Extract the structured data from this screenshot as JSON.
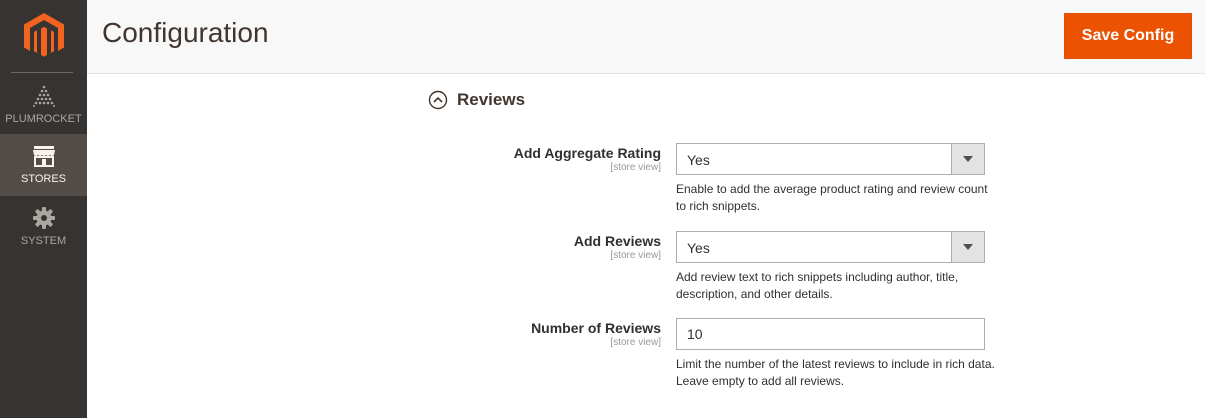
{
  "sidebar": {
    "logo_icon": "magento-logo-icon",
    "items": [
      {
        "label": "PLUMROCKET",
        "icon": "plumrocket-icon",
        "active": false
      },
      {
        "label": "STORES",
        "icon": "store-icon",
        "active": true
      },
      {
        "label": "SYSTEM",
        "icon": "gear-icon",
        "active": false
      }
    ]
  },
  "header": {
    "title": "Configuration",
    "save_label": "Save Config"
  },
  "section": {
    "title": "Reviews",
    "icon": "chevron-up-circle-icon"
  },
  "fields": [
    {
      "label": "Add Aggregate Rating",
      "scope": "[store view]",
      "type": "select",
      "value": "Yes",
      "note": "Enable to add the average product rating and review count to rich snippets."
    },
    {
      "label": "Add Reviews",
      "scope": "[store view]",
      "type": "select",
      "value": "Yes",
      "note": "Add review text to rich snippets including author, title, description, and other details."
    },
    {
      "label": "Number of Reviews",
      "scope": "[store view]",
      "type": "text",
      "value": "10",
      "note": "Limit the number of the latest reviews to include in rich data. Leave empty to add all reviews."
    }
  ],
  "colors": {
    "sidebar_bg": "#373330",
    "sidebar_active": "#524d49",
    "accent": "#eb5202",
    "logo_orange": "#f26322"
  }
}
